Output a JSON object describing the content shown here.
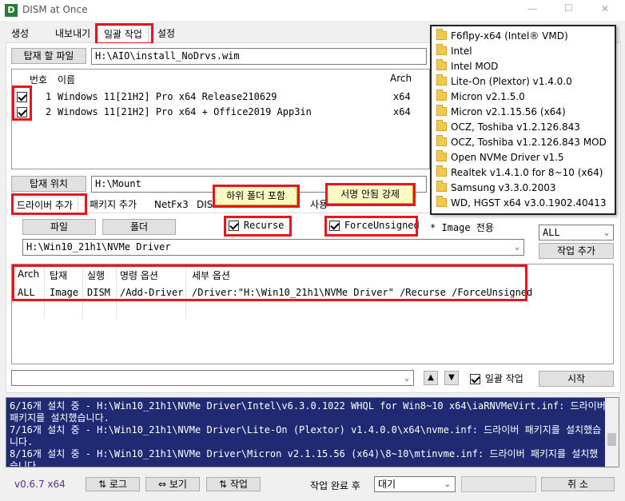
{
  "titlebar": {
    "title": "DISM at Once",
    "app_icon_letter": "D",
    "minimize": "—",
    "maximize": "☐",
    "close": "✕"
  },
  "tabs": [
    "생성",
    "내보내기",
    "일괄 작업",
    "설정"
  ],
  "mount_file": {
    "button_label": "탑재 할 파일",
    "path": "H:\\AIO\\install_NoDrvs.wim"
  },
  "image_table": {
    "headers": {
      "num": "번호",
      "name": "이름",
      "arch": "Arch"
    },
    "rows": [
      {
        "checked": true,
        "num": "1",
        "name": "Windows 11[21H2] Pro x64 Release210629",
        "arch": "x64"
      },
      {
        "checked": true,
        "num": "2",
        "name": "Windows 11[21H2] Pro x64 + Office2019 App3in",
        "arch": "x64"
      }
    ]
  },
  "mount_location": {
    "button_label": "탑재 위치",
    "path": "H:\\Mount"
  },
  "sub_tabs": [
    "드라이버 추가",
    "패키지 추가",
    "NetFx3",
    "DIS",
    "사용"
  ],
  "driver": {
    "file_button": "파일",
    "folder_button": "폴더",
    "recurse_label": "Recurse",
    "recurse_checked": true,
    "force_label": "ForceUnsigned",
    "force_checked": true,
    "image_only_note": "* Image 전용",
    "path": "H:\\Win10_21h1\\NVMe Driver"
  },
  "tooltips": {
    "recurse": "하위 폴더 포함",
    "force": "서명 안됨 강제"
  },
  "arch_select": "ALL",
  "add_task_button": "작업 추가",
  "task_table": {
    "headers": {
      "arch": "Arch",
      "mount": "탑재",
      "exec": "실행",
      "cmd": "명령 옵션",
      "detail": "세부 옵션"
    },
    "rows": [
      {
        "arch": "ALL",
        "mount": "Image",
        "exec": "DISM",
        "cmd": "/Add-Driver",
        "detail": "/Driver:\"H:\\Win10_21h1\\NVMe Driver\" /Recurse /ForceUnsigned"
      }
    ]
  },
  "batch": {
    "up": "▲",
    "down": "▼",
    "batch_label": "일괄 작업",
    "batch_checked": true,
    "start_button": "시작"
  },
  "log_lines": [
    "6/16개 설치 중 - H:\\Win10_21h1\\NVMe Driver\\Intel\\v6.3.0.1022 WHQL for Win8~10 x64\\iaRNVMeVirt.inf: 드라이버",
    "패키지를 설치했습니다.",
    "7/16개 설치 중 - H:\\Win10_21h1\\NVMe Driver\\Lite-On (Plextor) v1.4.0.0\\x64\\nvme.inf: 드라이버 패키지를 설치했습",
    "니다.",
    "8/16개 설치 중 - H:\\Win10_21h1\\NVMe Driver\\Micron v2.1.15.56 (x64)\\8~10\\mtinvme.inf: 드라이버 패키지를 설치했",
    "습니다."
  ],
  "statusbar": {
    "version": "v0.6.7 x64",
    "log_button": "⇅ 로그",
    "view_button": "⇔ 보기",
    "task_button": "⇅ 작업",
    "after_label": "작업 완료 후",
    "after_select": "대기",
    "cancel_button": "취 소"
  },
  "folder_dropdown": [
    "F6flpy-x64 (Intel® VMD)",
    "Intel",
    "Intel MOD",
    "Lite-On (Plextor) v1.4.0.0",
    "Micron v2.1.5.0",
    "Micron v2.1.15.56 (x64)",
    "OCZ, Toshiba v1.2.126.843",
    "OCZ, Toshiba v1.2.126.843 MOD",
    "Open NVMe Driver v1.5",
    "Realtek v1.4.1.0 for 8~10 (x64)",
    "Samsung v3.3.0.2003",
    "WD, HGST x64 v3.0.1902.40413"
  ],
  "colors": {
    "highlight_red": "#e8161c",
    "log_background": "#1f2a73",
    "tooltip_background": "#fff9c4",
    "version_text": "#5a2d91"
  }
}
